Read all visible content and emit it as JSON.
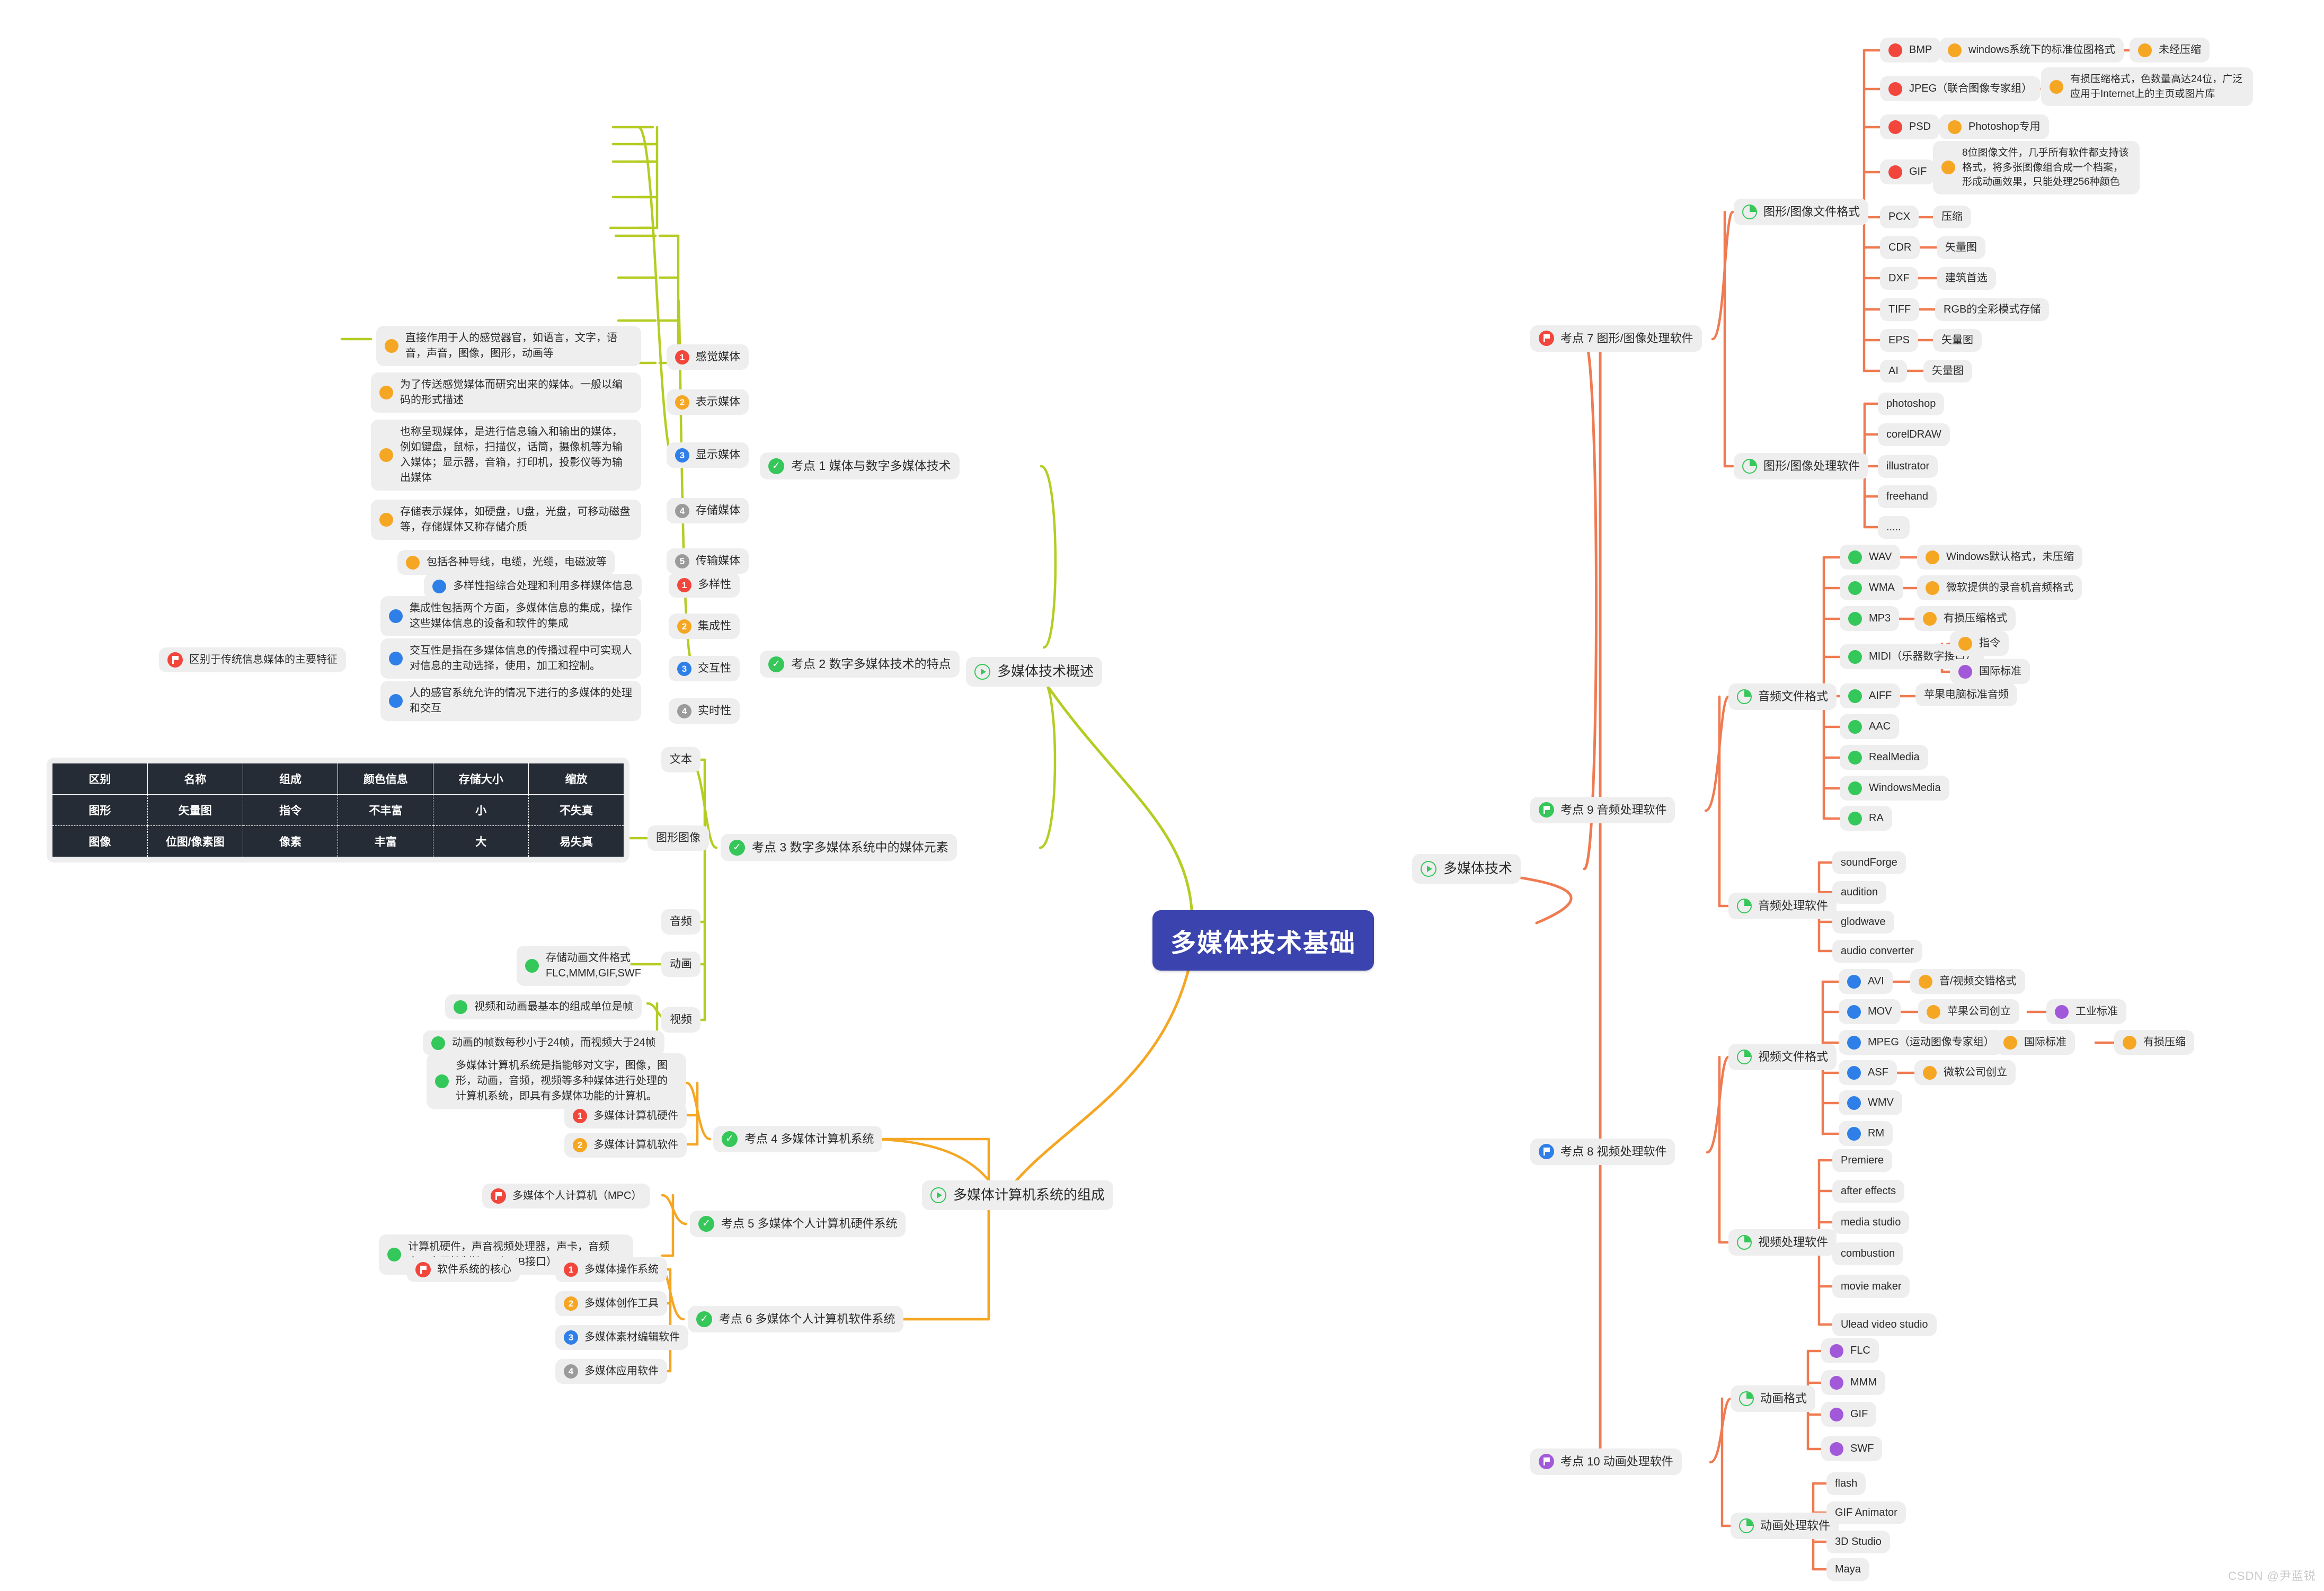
{
  "watermark": "CSDN @尹蓝锐",
  "root": {
    "label": "多媒体技术基础"
  },
  "branches": {
    "overview": {
      "label": "多媒体技术概述"
    },
    "tech": {
      "label": "多媒体技术"
    },
    "composition": {
      "label": "多媒体计算机系统的组成"
    }
  },
  "kp1": {
    "label": "考点 1 媒体与数字多媒体技术",
    "items": [
      {
        "n": "1",
        "label": "感觉媒体",
        "desc": "直接作用于人的感觉器官，如语言，文字，语音，声音，图像，图形，动画等"
      },
      {
        "n": "2",
        "label": "表示媒体",
        "desc": "为了传送感觉媒体而研究出来的媒体。一般以编码的形式描述"
      },
      {
        "n": "3",
        "label": "显示媒体",
        "desc": "也称呈现媒体，是进行信息输入和输出的媒体，例如键盘，鼠标，扫描仪，话筒，摄像机等为输入媒体；显示器，音箱，打印机，投影仪等为输出媒体"
      },
      {
        "n": "4",
        "label": "存储媒体",
        "desc": "存储表示媒体，如硬盘，U盘，光盘，可移动磁盘等，存储媒体又称存储介质"
      },
      {
        "n": "5",
        "label": "传输媒体",
        "desc": "包括各种导线，电缆，光缆，电磁波等"
      }
    ]
  },
  "kp2": {
    "label": "考点 2 数字多媒体技术的特点",
    "summary": "区别于传统信息媒体的主要特征",
    "items": [
      {
        "n": "1",
        "label": "多样性",
        "desc": "多样性指综合处理和利用多样媒体信息"
      },
      {
        "n": "2",
        "label": "集成性",
        "desc": "集成性包括两个方面，多媒体信息的集成，操作这些媒体信息的设备和软件的集成"
      },
      {
        "n": "3",
        "label": "交互性",
        "desc": "交互性是指在多媒体信息的传播过程中可实现人对信息的主动选择，使用，加工和控制。"
      },
      {
        "n": "4",
        "label": "实时性",
        "desc": "人的感官系统允许的情况下进行的多媒体的处理和交互"
      }
    ]
  },
  "kp3": {
    "label": "考点 3 数字多媒体系统中的媒体元素",
    "items": [
      {
        "label": "文本"
      },
      {
        "label": "图形图像"
      },
      {
        "label": "音频"
      },
      {
        "label": "动画"
      },
      {
        "label": "视频"
      }
    ],
    "animation_note": "存储动画文件格式\nFLC,MMM,GIF,SWF",
    "video_notes": [
      "视频和动画最基本的组成单位是帧",
      "动画的帧数每秒小于24帧，而视频大于24帧"
    ],
    "table": {
      "headers": [
        "区别",
        "名称",
        "组成",
        "颜色信息",
        "存储大小",
        "缩放"
      ],
      "rows": [
        [
          "图形",
          "矢量图",
          "指令",
          "不丰富",
          "小",
          "不失真"
        ],
        [
          "图像",
          "位图/像素图",
          "像素",
          "丰富",
          "大",
          "易失真"
        ]
      ]
    }
  },
  "kp4": {
    "label": "考点 4 多媒体计算机系统",
    "desc": "多媒体计算机系统是指能够对文字，图像，图形，动画，音频，视频等多种媒体进行处理的计算机系统，即具有多媒体功能的计算机。",
    "items": [
      {
        "n": "1",
        "label": "多媒体计算机硬件"
      },
      {
        "n": "2",
        "label": "多媒体计算机软件"
      }
    ]
  },
  "kp5": {
    "label": "考点 5 多媒体个人计算机硬件系统",
    "items": [
      {
        "label": "多媒体个人计算机（MPC）",
        "badge": "flag-red"
      },
      {
        "label": "计算机硬件，声音视频处理器，声卡，音频卡，交互控制接口（USB接口）",
        "badge": "dot-green"
      }
    ]
  },
  "kp6": {
    "label": "考点 6 多媒体个人计算机软件系统",
    "core_note": "软件系统的核心",
    "items": [
      {
        "n": "1",
        "label": "多媒体操作系统"
      },
      {
        "n": "2",
        "label": "多媒体创作工具"
      },
      {
        "n": "3",
        "label": "多媒体素材编辑软件"
      },
      {
        "n": "4",
        "label": "多媒体应用软件"
      }
    ]
  },
  "kp7": {
    "label": "考点 7 图形/图像处理软件",
    "formats_label": "图形/图像文件格式",
    "formats": [
      {
        "name": "BMP",
        "note": "windows系统下的标准位图格式",
        "note2": "未经压缩"
      },
      {
        "name": "JPEG（联合图像专家组）",
        "note": "有损压缩格式，色数量高达24位，广泛应用于Internet上的主页或图片库"
      },
      {
        "name": "PSD",
        "note": "Photoshop专用"
      },
      {
        "name": "GIF",
        "note": "8位图像文件，几乎所有软件都支持该格式，将多张图像组合成一个档案，形成动画效果，只能处理256种颜色"
      },
      {
        "name": "PCX",
        "note": "压缩"
      },
      {
        "name": "CDR",
        "note": "矢量图"
      },
      {
        "name": "DXF",
        "note": "建筑首选"
      },
      {
        "name": "TIFF",
        "note": "RGB的全彩模式存储"
      },
      {
        "name": "EPS",
        "note": "矢量图"
      },
      {
        "name": "AI",
        "note": "矢量图"
      }
    ],
    "software_label": "图形/图像处理软件",
    "software": [
      "photoshop",
      "corelDRAW",
      "illustrator",
      "freehand",
      "....."
    ]
  },
  "kp9": {
    "label": "考点 9 音频处理软件",
    "formats_label": "音频文件格式",
    "formats": [
      {
        "name": "WAV",
        "note": "Windows默认格式，未压缩"
      },
      {
        "name": "WMA",
        "note": "微软提供的录音机音频格式"
      },
      {
        "name": "MP3",
        "note": "有损压缩格式"
      },
      {
        "name": "MIDI（乐器数字接口）",
        "sub": [
          "指令",
          "国际标准"
        ]
      },
      {
        "name": "AIFF",
        "note": "苹果电脑标准音频"
      },
      {
        "name": "AAC"
      },
      {
        "name": "RealMedia"
      },
      {
        "name": "WindowsMedia"
      },
      {
        "name": "RA"
      }
    ],
    "software_label": "音频处理软件",
    "software": [
      "soundForge",
      "audition",
      "glodwave",
      "audio converter"
    ]
  },
  "kp8": {
    "label": "考点 8 视频处理软件",
    "formats_label": "视频文件格式",
    "formats": [
      {
        "name": "AVI",
        "note": "音/视频交错格式"
      },
      {
        "name": "MOV",
        "note": "苹果公司创立",
        "note2": "工业标准"
      },
      {
        "name": "MPEG（运动图像专家组）",
        "note": "国际标准",
        "note2": "有损压缩"
      },
      {
        "name": "ASF",
        "note": "微软公司创立"
      },
      {
        "name": "WMV"
      },
      {
        "name": "RM"
      }
    ],
    "software_label": "视频处理软件",
    "software": [
      "Premiere",
      "after effects",
      "media studio",
      "combustion",
      "movie maker",
      "Ulead video studio"
    ]
  },
  "kp10": {
    "label": "考点 10 动画处理软件",
    "formats_label": "动画格式",
    "formats": [
      "FLC",
      "MMM",
      "GIF",
      "SWF"
    ],
    "software_label": "动画处理软件",
    "software": [
      "flash",
      "GIF Animator",
      "3D Studio",
      "Maya"
    ]
  },
  "colors": {
    "root_bg": "#3b44ae",
    "node_bg": "#eeeeee",
    "link_green": "#b5cc22",
    "link_orange": "#f5a623",
    "link_salmon": "#f07a51",
    "table_bg": "#252c35"
  }
}
